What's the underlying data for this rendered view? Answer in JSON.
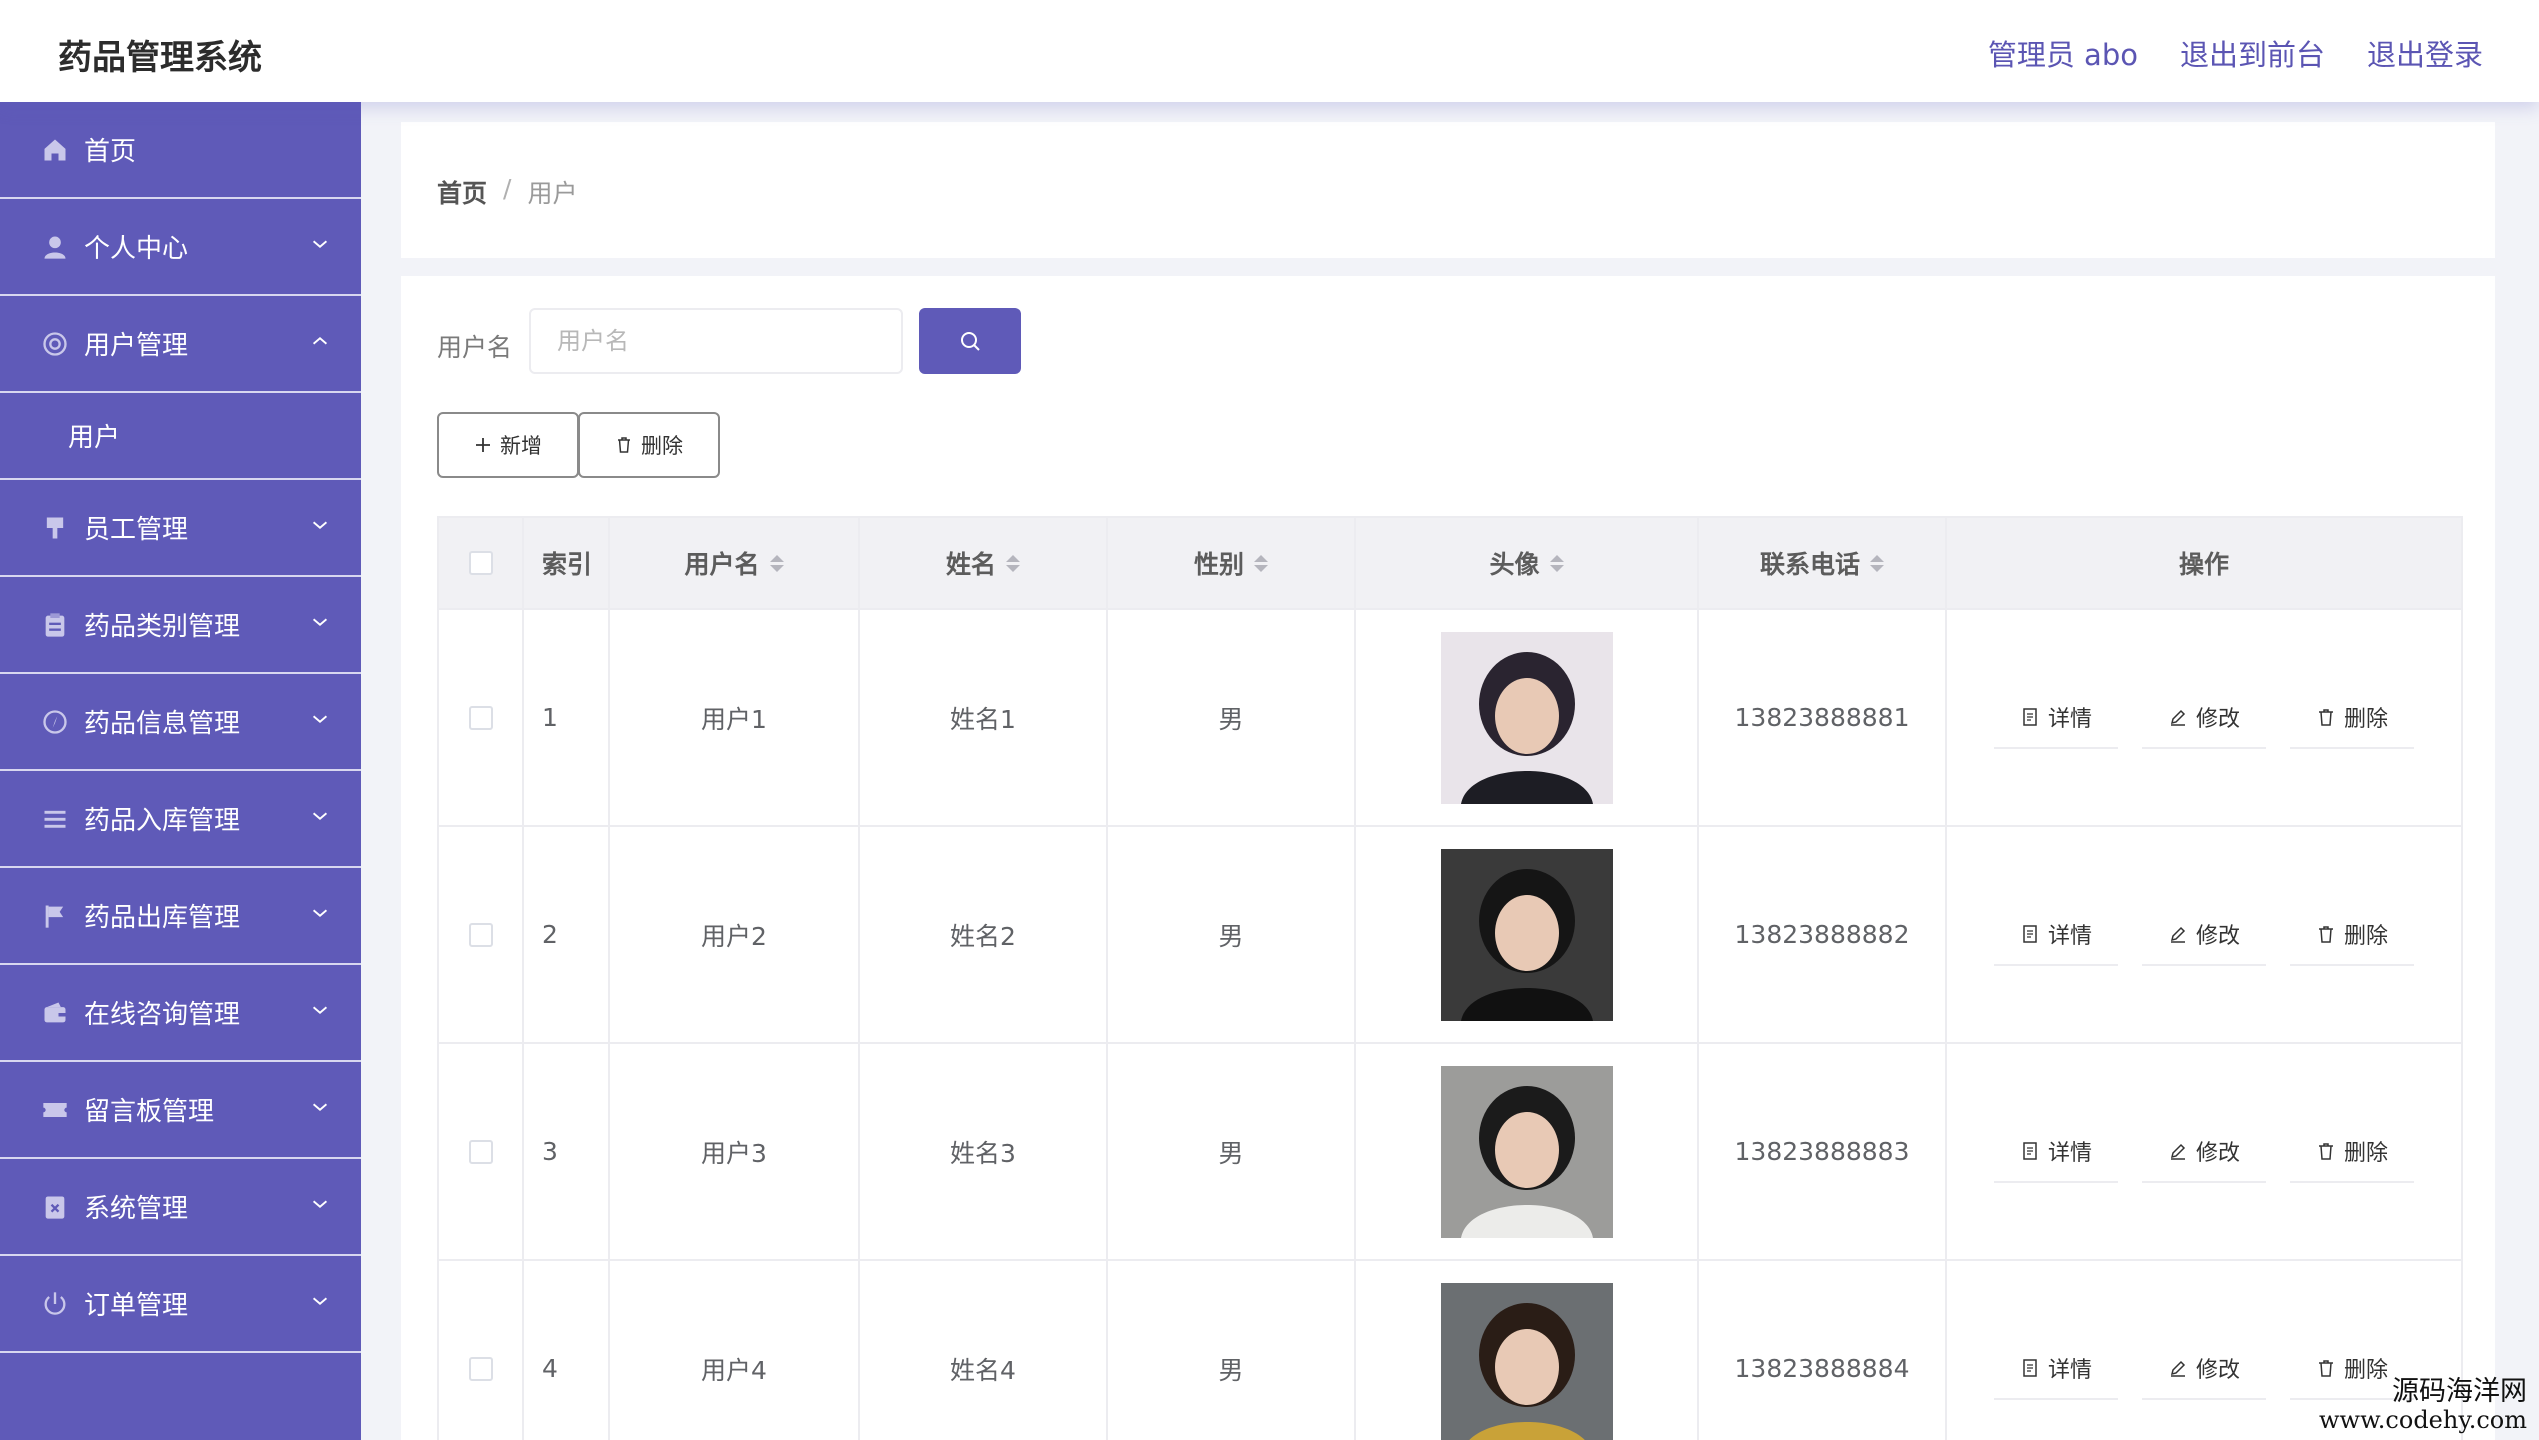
{
  "header": {
    "title": "药品管理系统",
    "admin": "管理员 abo",
    "to_front": "退出到前台",
    "logout": "退出登录"
  },
  "sidebar": {
    "items": [
      {
        "label": "首页",
        "icon": "home-icon",
        "chevron": false
      },
      {
        "label": "个人中心",
        "icon": "user-icon",
        "chevron": true
      },
      {
        "label": "用户管理",
        "icon": "lifebuoy-icon",
        "chevron": true,
        "expanded": true
      },
      {
        "label": "员工管理",
        "icon": "brush-icon",
        "chevron": true
      },
      {
        "label": "药品类别管理",
        "icon": "clipboard-icon",
        "chevron": true
      },
      {
        "label": "药品信息管理",
        "icon": "compass-icon",
        "chevron": true
      },
      {
        "label": "药品入库管理",
        "icon": "list-icon",
        "chevron": true
      },
      {
        "label": "药品出库管理",
        "icon": "flag-icon",
        "chevron": true
      },
      {
        "label": "在线咨询管理",
        "icon": "wallet-icon",
        "chevron": true
      },
      {
        "label": "留言板管理",
        "icon": "ticket-icon",
        "chevron": true
      },
      {
        "label": "系统管理",
        "icon": "doc-x-icon",
        "chevron": true
      },
      {
        "label": "订单管理",
        "icon": "power-icon",
        "chevron": true
      }
    ],
    "sub_items": [
      {
        "label": "用户"
      }
    ]
  },
  "breadcrumb": {
    "home": "首页",
    "sep": "/",
    "current": "用户"
  },
  "search": {
    "label": "用户名",
    "placeholder": "用户名",
    "value": ""
  },
  "toolbar": {
    "add_label": "新增",
    "delete_label": "删除"
  },
  "table": {
    "columns": [
      "索引",
      "用户名",
      "姓名",
      "性别",
      "头像",
      "联系电话",
      "操作"
    ],
    "rows": [
      {
        "index": "1",
        "username": "用户1",
        "name": "姓名1",
        "sex": "男",
        "phone": "13823888881",
        "avatar_hair": "#2a2430",
        "avatar_bg": "#e9e4ea",
        "avatar_cloth": "#1d1d24"
      },
      {
        "index": "2",
        "username": "用户2",
        "name": "姓名2",
        "sex": "男",
        "phone": "13823888882",
        "avatar_hair": "#151515",
        "avatar_bg": "#3a3a3a",
        "avatar_cloth": "#111111"
      },
      {
        "index": "3",
        "username": "用户3",
        "name": "姓名3",
        "sex": "男",
        "phone": "13823888883",
        "avatar_hair": "#1b1b1b",
        "avatar_bg": "#9c9c9a",
        "avatar_cloth": "#ececea"
      },
      {
        "index": "4",
        "username": "用户4",
        "name": "姓名4",
        "sex": "男",
        "phone": "13823888884",
        "avatar_hair": "#2a1d16",
        "avatar_bg": "#6b6f72",
        "avatar_cloth": "#c9a238"
      }
    ],
    "ops": {
      "detail": "详情",
      "edit": "修改",
      "delete": "删除"
    }
  },
  "watermark": {
    "line1": "源码海洋网",
    "line2": "www.codehy.com"
  },
  "colors": {
    "accent": "#5f5ab8",
    "sidebar_bg": "#5f5ab8",
    "header_link": "#5b55b3"
  }
}
